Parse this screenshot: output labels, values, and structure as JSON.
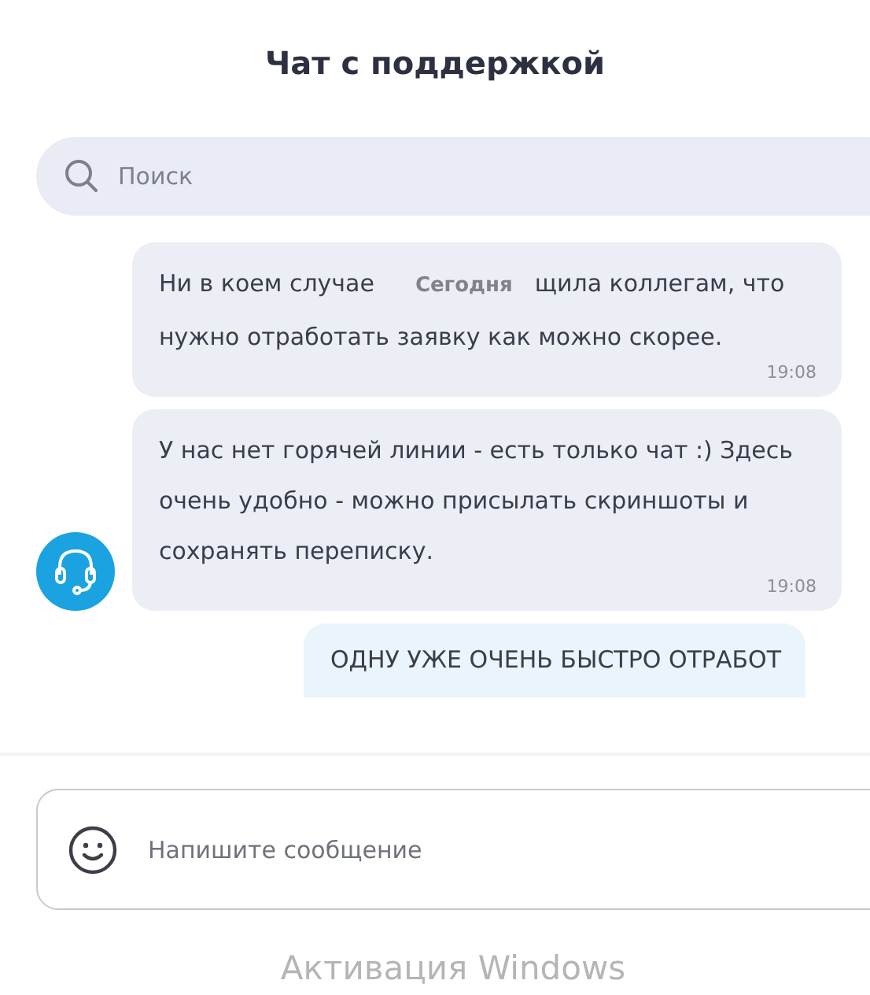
{
  "title": "Чат с поддержкой",
  "search": {
    "placeholder": "Поиск"
  },
  "messages": [
    {
      "kind": "support",
      "avatar": false,
      "text_before": "Ни в коем случае",
      "date_label": "Сегодня",
      "text_after": "щила коллегам, что нужно отработать заявку как можно скорее.",
      "time": "19:08"
    },
    {
      "kind": "support",
      "avatar": true,
      "text_after": "У нас нет горячей линии - есть только чат :) Здесь очень удобно - можно присылать скриншоты и сохранять переписку.",
      "time": "19:08"
    },
    {
      "kind": "user",
      "avatar": false,
      "text_after": "ОДНУ УЖЕ ОЧЕНЬ БЫСТРО ОТРАБОТ"
    }
  ],
  "composer": {
    "placeholder": "Напишите сообщение"
  },
  "os_notice": "Активация Windows"
}
